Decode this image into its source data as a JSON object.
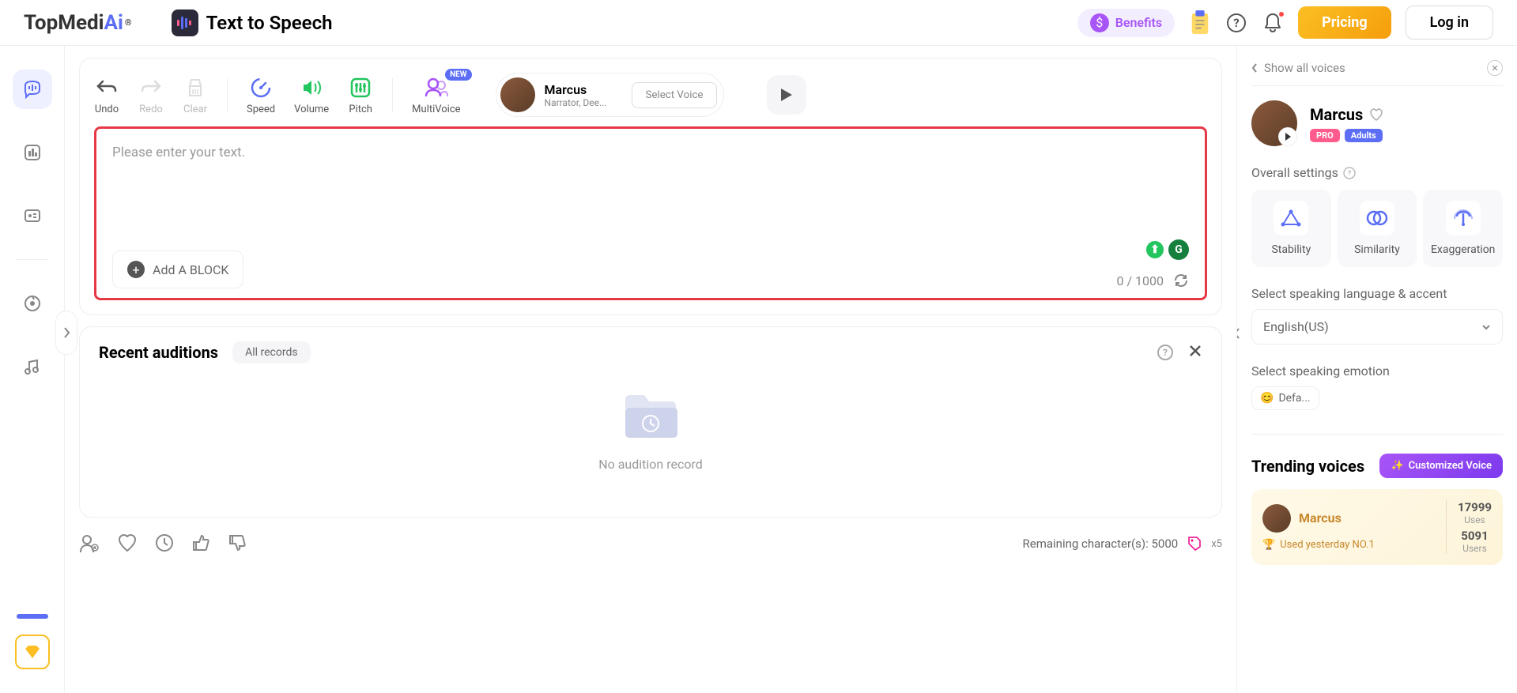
{
  "header": {
    "logo_pre": "TopMedi",
    "logo_ai": "Ai",
    "app_title": "Text to Speech",
    "benefits": "Benefits",
    "pricing": "Pricing",
    "login": "Log in"
  },
  "toolbar": {
    "undo": "Undo",
    "redo": "Redo",
    "clear": "Clear",
    "speed": "Speed",
    "volume": "Volume",
    "pitch": "Pitch",
    "multivoice": "MultiVoice",
    "new_badge": "NEW",
    "voice_name": "Marcus",
    "voice_desc": "Narrator, Dee...",
    "select_voice": "Select Voice"
  },
  "editor": {
    "placeholder": "Please enter your text.",
    "add_block": "Add A BLOCK",
    "count": "0 / 1000"
  },
  "auditions": {
    "title": "Recent auditions",
    "all_records": "All records",
    "empty": "No audition record"
  },
  "bottom": {
    "remaining": "Remaining character(s): 5000",
    "x5": "x5"
  },
  "right": {
    "show_all": "Show all voices",
    "voice_name": "Marcus",
    "badge_pro": "PRO",
    "badge_adults": "Adults",
    "overall_settings": "Overall settings",
    "stability": "Stability",
    "similarity": "Similarity",
    "exaggeration": "Exaggeration",
    "lang_label": "Select speaking language & accent",
    "lang_value": "English(US)",
    "emotion_label": "Select speaking emotion",
    "emotion_value": "Defa...",
    "trending": "Trending voices",
    "custom_voice": "Customized Voice",
    "trend_name": "Marcus",
    "trend_sub": "Used yesterday NO.1",
    "uses_num": "17999",
    "uses_label": "Uses",
    "users_num": "5091",
    "users_label": "Users"
  }
}
